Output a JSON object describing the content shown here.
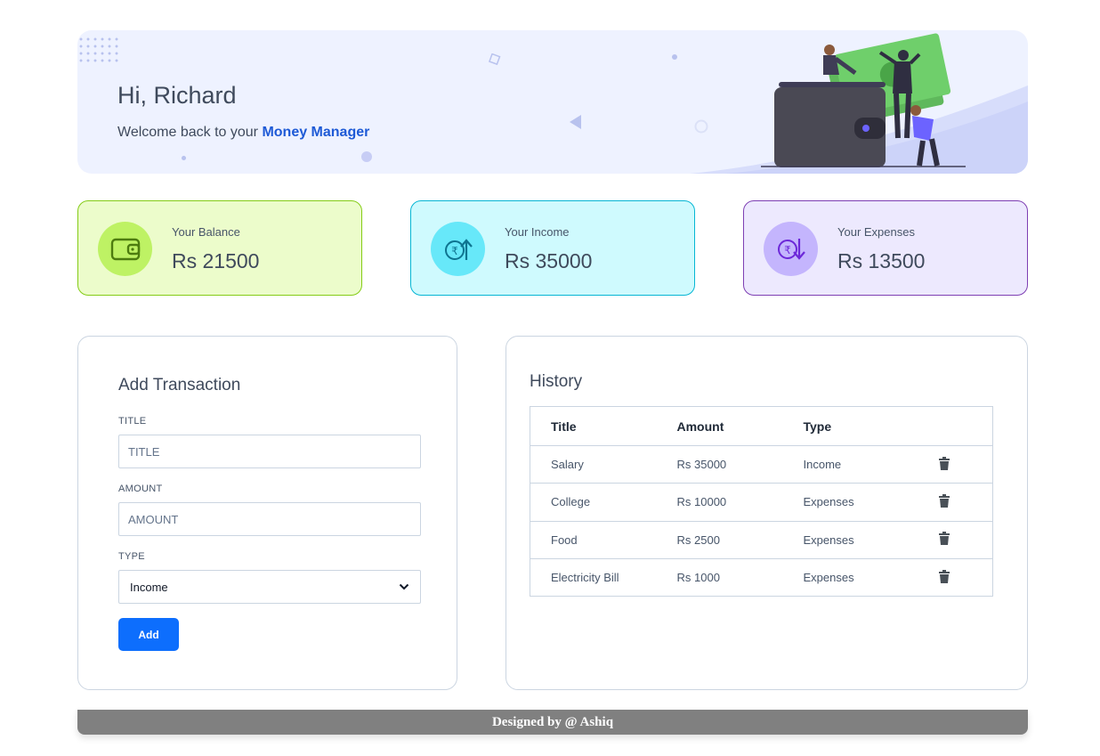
{
  "banner": {
    "greeting": "Hi, Richard",
    "welcome_prefix": "Welcome back to your ",
    "brand": "Money Manager"
  },
  "stats": {
    "balance": {
      "label": "Your Balance",
      "value": "Rs 21500",
      "icon": "wallet-icon"
    },
    "income": {
      "label": "Your Income",
      "value": "Rs 35000",
      "icon": "rupee-up-icon"
    },
    "expenses": {
      "label": "Your Expenses",
      "value": "Rs 13500",
      "icon": "rupee-down-icon"
    }
  },
  "form": {
    "title": "Add Transaction",
    "title_label": "TITLE",
    "title_placeholder": "TITLE",
    "amount_label": "AMOUNT",
    "amount_placeholder": "AMOUNT",
    "type_label": "TYPE",
    "type_selected": "Income",
    "add_label": "Add"
  },
  "history": {
    "title": "History",
    "columns": [
      "Title",
      "Amount",
      "Type"
    ],
    "rows": [
      {
        "title": "Salary",
        "amount": "Rs 35000",
        "type": "Income"
      },
      {
        "title": "College",
        "amount": "Rs 10000",
        "type": "Expenses"
      },
      {
        "title": "Food",
        "amount": "Rs 2500",
        "type": "Expenses"
      },
      {
        "title": "Electricity Bill",
        "amount": "Rs 1000",
        "type": "Expenses"
      }
    ]
  },
  "footer": {
    "text": "Designed by @ Ashiq"
  },
  "colors": {
    "brand": "#1e5ad6",
    "add_button": "#0d6efd",
    "balance_bg": "#ecfccb",
    "income_bg": "#cffafe",
    "expenses_bg": "#ede9fe"
  }
}
